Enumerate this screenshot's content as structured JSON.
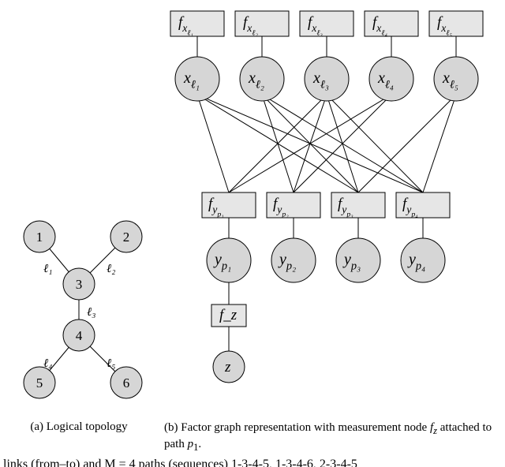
{
  "topology": {
    "nodes": [
      "1",
      "2",
      "3",
      "4",
      "5",
      "6"
    ],
    "links": [
      "ℓ₁",
      "ℓ₂",
      "ℓ₃",
      "ℓ₄",
      "ℓ₅"
    ],
    "edges": [
      {
        "from": "1",
        "to": "3",
        "label": "ℓ₁"
      },
      {
        "from": "2",
        "to": "3",
        "label": "ℓ₂"
      },
      {
        "from": "3",
        "to": "4",
        "label": "ℓ₃"
      },
      {
        "from": "4",
        "to": "5",
        "label": "ℓ₄"
      },
      {
        "from": "4",
        "to": "6",
        "label": "ℓ₅"
      }
    ]
  },
  "factor_graph": {
    "x_factor_labels": [
      "f_{x_{ℓ₁}}",
      "f_{x_{ℓ₂}}",
      "f_{x_{ℓ₃}}",
      "f_{x_{ℓ₄}}",
      "f_{x_{ℓ₅}}"
    ],
    "x_var_labels": [
      "x_{ℓ₁}",
      "x_{ℓ₂}",
      "x_{ℓ₃}",
      "x_{ℓ₄}",
      "x_{ℓ₅}"
    ],
    "y_factor_labels": [
      "f_{y_{p₁}}",
      "f_{y_{p₂}}",
      "f_{y_{p₃}}",
      "f_{y_{p₄}}"
    ],
    "y_var_labels": [
      "y_{p₁}",
      "y_{p₂}",
      "y_{p₃}",
      "y_{p₄}"
    ],
    "z_factor_label": "f_z",
    "z_var_label": "z",
    "bipartite_edges": [
      [
        0,
        0
      ],
      [
        0,
        2
      ],
      [
        0,
        3
      ],
      [
        1,
        1
      ],
      [
        1,
        2
      ],
      [
        1,
        3
      ],
      [
        2,
        0
      ],
      [
        2,
        1
      ],
      [
        2,
        2
      ],
      [
        2,
        3
      ],
      [
        3,
        0
      ],
      [
        3,
        1
      ],
      [
        4,
        2
      ],
      [
        4,
        3
      ]
    ]
  },
  "captions": {
    "a": "(a) Logical topology",
    "b": "(b) Factor graph representation with measurement node f_z attached to path p₁."
  },
  "footer": "links (from–to) and M = 4 paths (sequences) 1-3-4-5, 1-3-4-6, 2-3-4-5"
}
